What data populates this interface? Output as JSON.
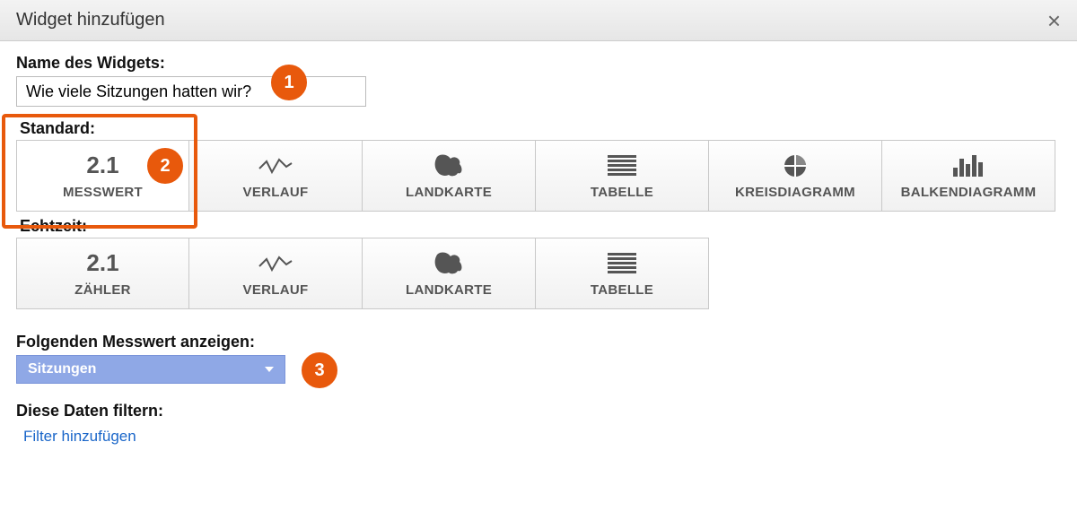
{
  "dialog": {
    "title": "Widget hinzufügen"
  },
  "name_field": {
    "label": "Name des Widgets:",
    "value": "Wie viele Sitzungen hatten wir?"
  },
  "annotations": {
    "b1": "1",
    "b2": "2",
    "b3": "3"
  },
  "standard": {
    "label": "Standard:",
    "tiles": [
      {
        "icon_label": "2.1",
        "label": "MESSWERT"
      },
      {
        "label": "VERLAUF"
      },
      {
        "label": "LANDKARTE"
      },
      {
        "label": "TABELLE"
      },
      {
        "label": "KREISDIAGRAMM"
      },
      {
        "label": "BALKENDIAGRAMM"
      }
    ]
  },
  "realtime": {
    "label": "Echtzeit:",
    "tiles": [
      {
        "icon_label": "2.1",
        "label": "ZÄHLER"
      },
      {
        "label": "VERLAUF"
      },
      {
        "label": "LANDKARTE"
      },
      {
        "label": "TABELLE"
      }
    ]
  },
  "metric": {
    "label": "Folgenden Messwert anzeigen:",
    "selected": "Sitzungen"
  },
  "filter": {
    "label": "Diese Daten filtern:",
    "link": "Filter hinzufügen"
  }
}
